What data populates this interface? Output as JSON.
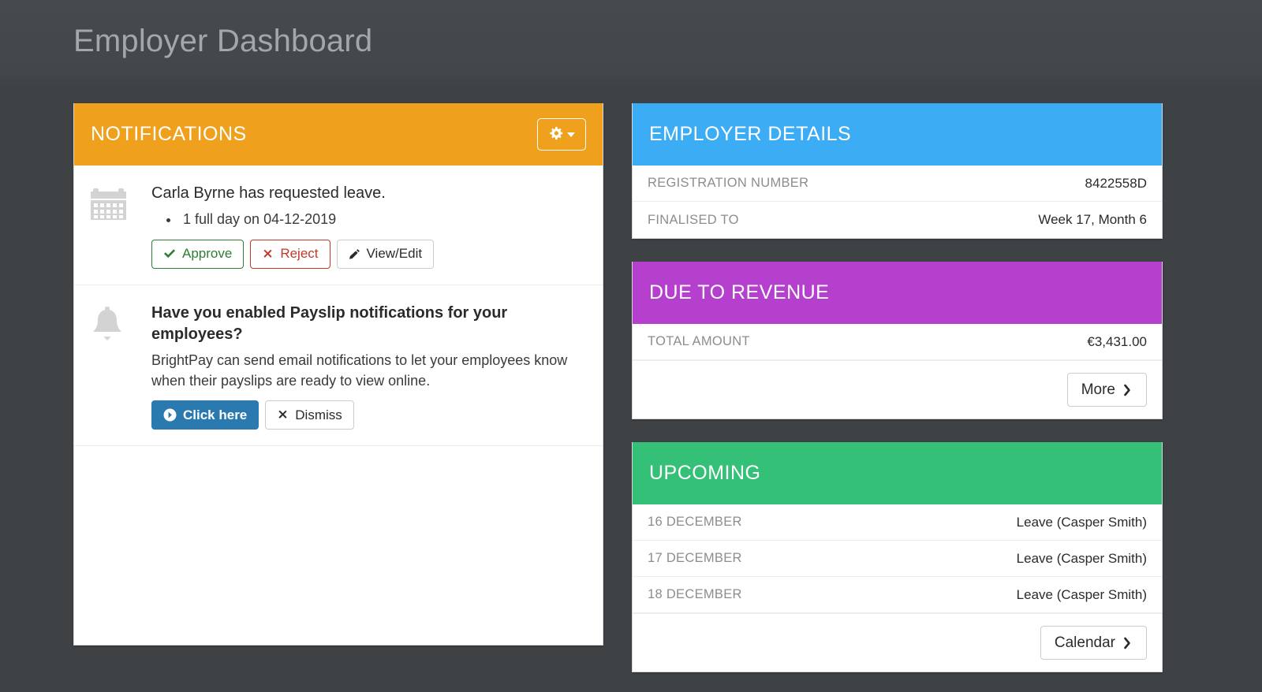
{
  "page": {
    "title": "Employer Dashboard",
    "background_color": "#3e4245"
  },
  "notifications_panel": {
    "header": {
      "title": "NOTIFICATIONS",
      "color": "#efa01c",
      "settings_button": {
        "icon": "gear-icon",
        "caret": "chevron-down-icon"
      }
    },
    "items": [
      {
        "icon": "calendar-icon",
        "title": "Carla Byrne has requested leave.",
        "bullets": [
          "1 full day on 04-12-2019"
        ],
        "buttons": [
          {
            "label": "Approve",
            "icon": "check-icon",
            "style": "approve",
            "color": "#2e7d32"
          },
          {
            "label": "Reject",
            "icon": "cross-icon",
            "style": "reject",
            "color": "#c0392b"
          },
          {
            "label": "View/Edit",
            "icon": "pencil-icon",
            "style": "default",
            "color": "#2b2b2b"
          }
        ]
      },
      {
        "icon": "bell-icon",
        "title": "Have you enabled Payslip notifications for your employees?",
        "body": "BrightPay can send email notifications to let your employees know when their payslips are ready to view online.",
        "buttons": [
          {
            "label": "Click here",
            "icon": "arrow-circle-right-icon",
            "style": "primary",
            "color": "#2a7ab0"
          },
          {
            "label": "Dismiss",
            "icon": "cross-icon",
            "style": "default",
            "color": "#2b2b2b"
          }
        ]
      }
    ]
  },
  "employer_details_panel": {
    "header": {
      "title": "EMPLOYER DETAILS",
      "color": "#3cacf4"
    },
    "rows": [
      {
        "label": "REGISTRATION NUMBER",
        "value": "8422558D"
      },
      {
        "label": "FINALISED TO",
        "value": "Week 17, Month 6"
      }
    ]
  },
  "due_to_revenue_panel": {
    "header": {
      "title": "DUE TO REVENUE",
      "color": "#b540cd"
    },
    "rows": [
      {
        "label": "TOTAL AMOUNT",
        "value": "€3,431.00"
      }
    ],
    "action": {
      "label": "More",
      "icon": "chevron-right-icon"
    }
  },
  "upcoming_panel": {
    "header": {
      "title": "UPCOMING",
      "color": "#35c077"
    },
    "rows": [
      {
        "label": "16 DECEMBER",
        "value": "Leave (Casper Smith)"
      },
      {
        "label": "17 DECEMBER",
        "value": "Leave (Casper Smith)"
      },
      {
        "label": "18 DECEMBER",
        "value": "Leave (Casper Smith)"
      }
    ],
    "action": {
      "label": "Calendar",
      "icon": "chevron-right-icon"
    }
  }
}
